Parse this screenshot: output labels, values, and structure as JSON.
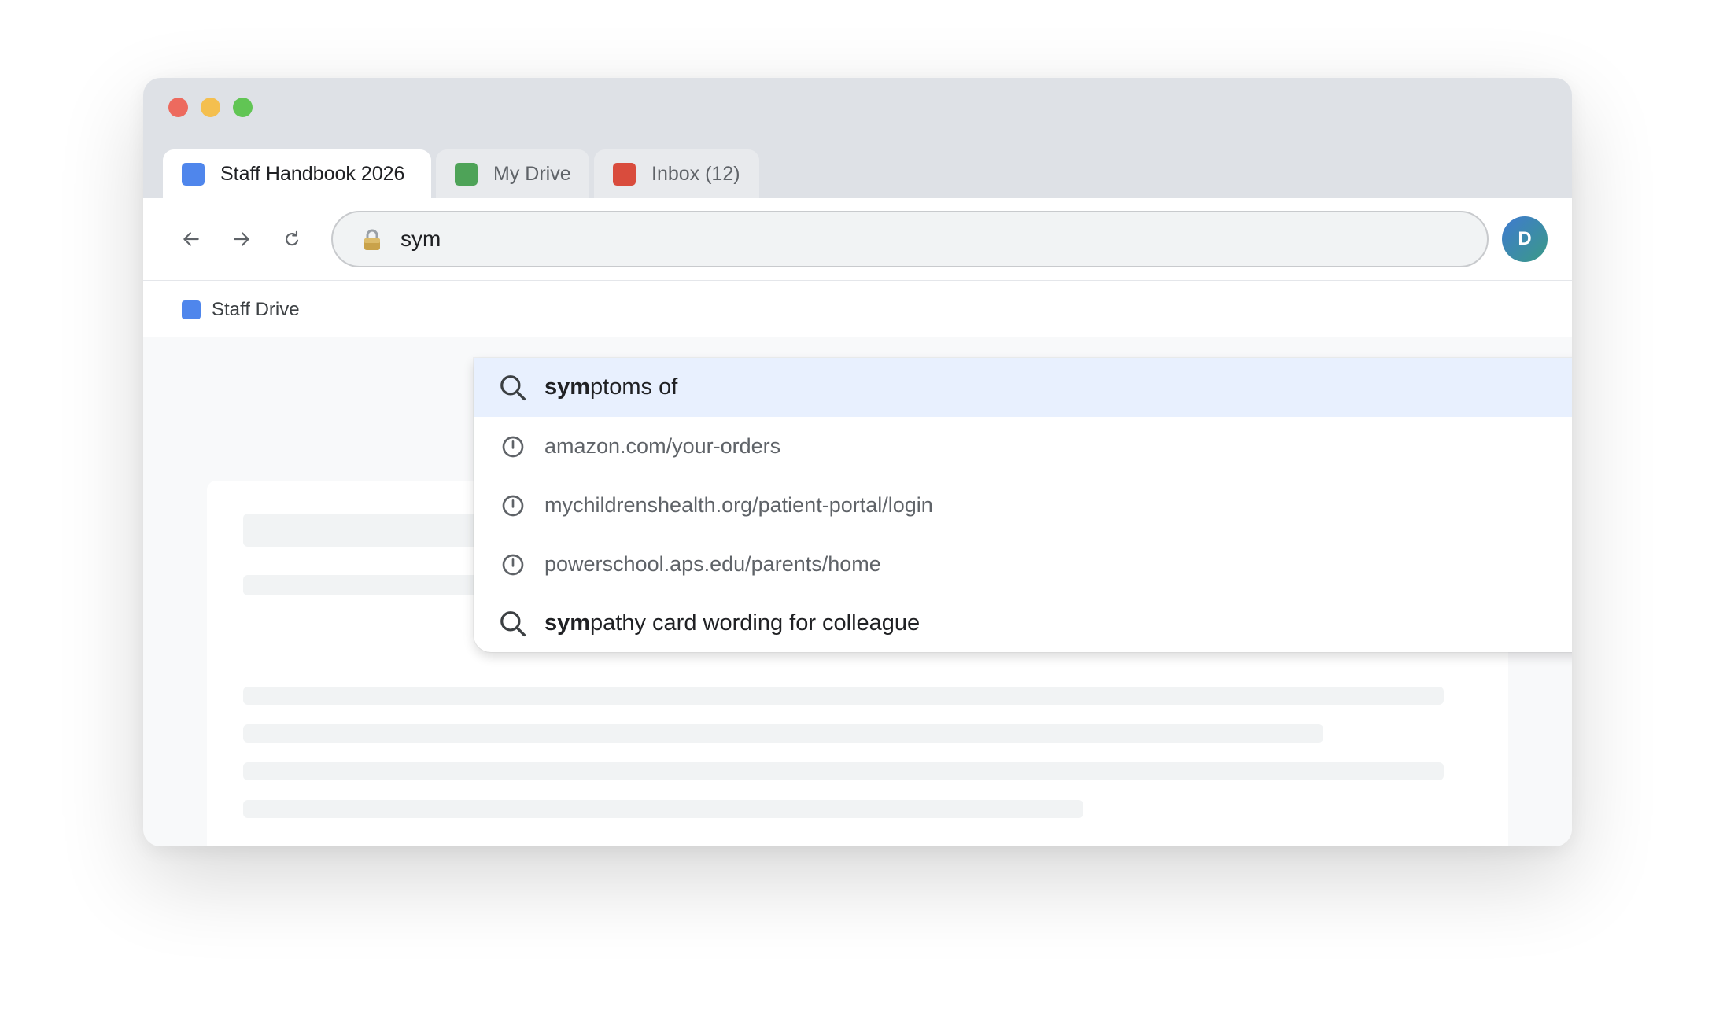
{
  "window": {
    "traffic_lights": [
      "close",
      "minimize",
      "zoom"
    ]
  },
  "tabs": [
    {
      "label": "Staff Handbook 2026",
      "favicon_color": "#4f86ec",
      "active": true
    },
    {
      "label": "My Drive",
      "favicon_color": "#4ea358",
      "active": false
    },
    {
      "label": "Inbox (12)",
      "favicon_color": "#d94c3d",
      "active": false
    }
  ],
  "toolbar": {
    "back_icon": "arrow-left-icon",
    "forward_icon": "arrow-right-icon",
    "reload_icon": "reload-icon",
    "lock_icon": "lock-icon",
    "omnibox_text": "sym",
    "avatar_initial": "D"
  },
  "bookmarks": [
    {
      "label": "Staff Drive",
      "favicon_color": "#4f86ec"
    }
  ],
  "omnibox_suggestions": [
    {
      "type": "search",
      "icon": "search-icon",
      "match": "sym",
      "rest": "ptoms of",
      "selected": true
    },
    {
      "type": "history",
      "icon": "history-clock-icon",
      "text": "amazon.com/your-orders",
      "selected": false
    },
    {
      "type": "history",
      "icon": "history-clock-icon",
      "text": "mychildrenshealth.org/patient-portal/login",
      "selected": false
    },
    {
      "type": "history",
      "icon": "history-clock-icon",
      "text": "powerschool.aps.edu/parents/home",
      "selected": false
    },
    {
      "type": "search",
      "icon": "search-icon",
      "match": "sym",
      "rest": "pathy card wording for colleague",
      "selected": false
    }
  ],
  "colors": {
    "accent": "#1a73e8",
    "selected_suggestion_bg": "#e8f0fe",
    "titlebar": "#dee1e6"
  }
}
